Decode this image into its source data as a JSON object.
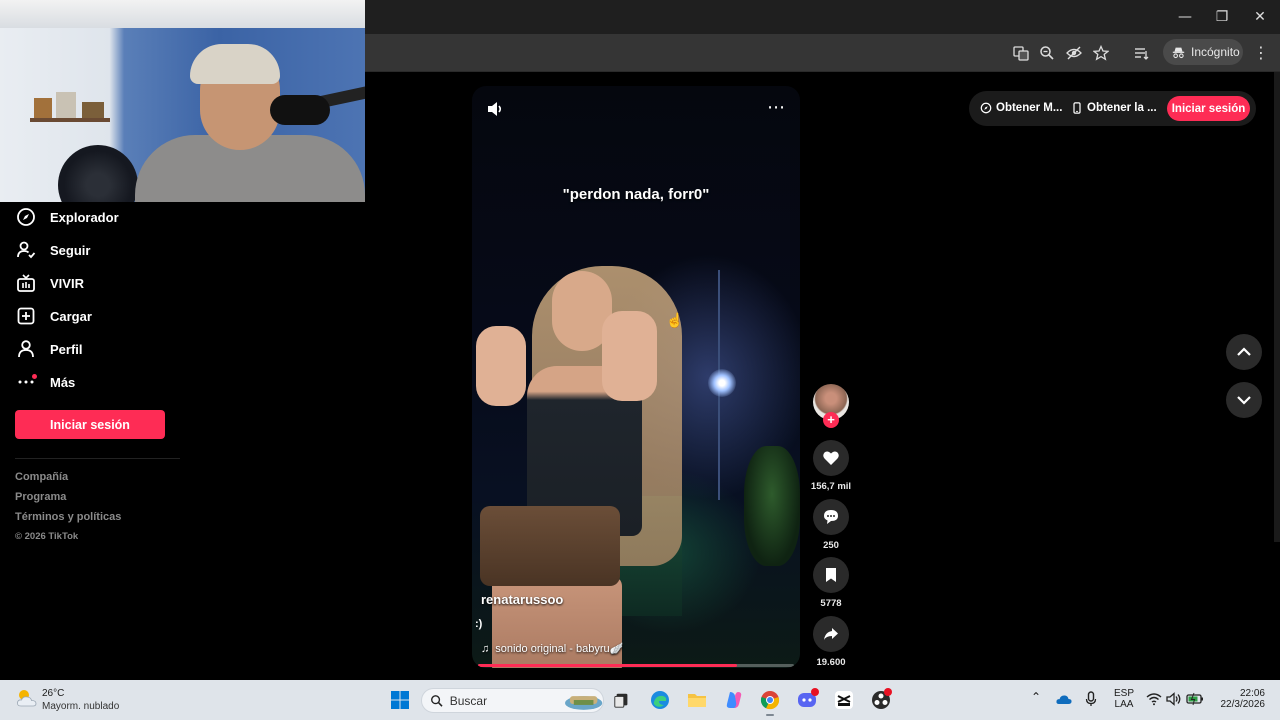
{
  "window": {
    "minimize": "—",
    "restore": "❐",
    "close": "✕"
  },
  "browser": {
    "incognito_label": "Incógnito"
  },
  "sidebar": {
    "items": [
      {
        "label": "Explorador"
      },
      {
        "label": "Seguir"
      },
      {
        "label": "VIVIR"
      },
      {
        "label": "Cargar"
      },
      {
        "label": "Perfil"
      },
      {
        "label": "Más"
      }
    ],
    "login_label": "Iniciar sesión",
    "footer_links": [
      "Compañía",
      "Programa",
      "Términos y políticas"
    ],
    "copyright": "© 2026 TikTok"
  },
  "video": {
    "caption": "\"perdon nada, forr0\"",
    "author": "renatarussoo",
    "description": ":)",
    "music": "sonido original - babyru🪽",
    "progress": 0.82
  },
  "actions": {
    "likes": "156,7 mil",
    "comments": "250",
    "saves": "5778",
    "shares": "19.600"
  },
  "top_bar": {
    "get_app_1": "Obtener M...",
    "get_app_2": "Obtener la ...",
    "login_label": "Iniciar sesión"
  },
  "taskbar": {
    "weather_temp": "26°C",
    "weather_desc": "Mayorm. nublado",
    "search_placeholder": "Buscar",
    "lang_1": "ESP",
    "lang_2": "LAA",
    "time": "22:06",
    "date": "22/3/2026"
  },
  "colors": {
    "accent": "#fe2c55",
    "taskbar_bg": "#dfe4ea"
  }
}
